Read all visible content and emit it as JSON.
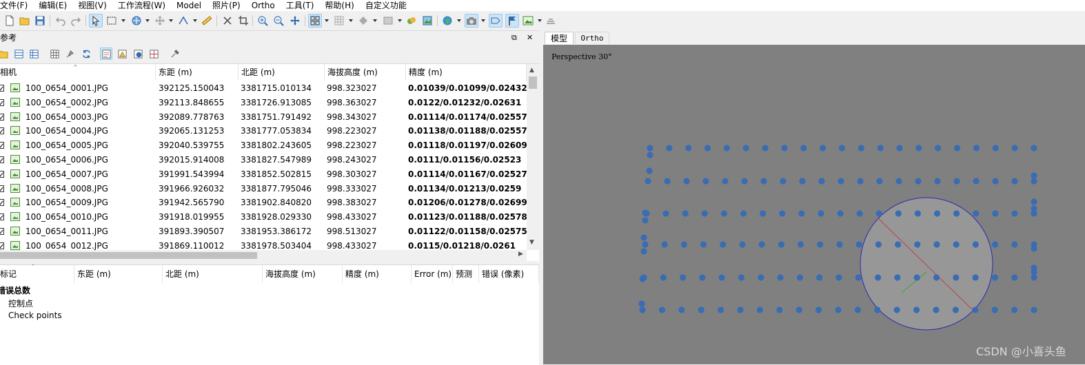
{
  "menu": [
    "文件(F)",
    "编辑(E)",
    "视图(V)",
    "工作流程(W)",
    "Model",
    "照片(P)",
    "Ortho",
    "工具(T)",
    "帮助(H)",
    "自定义功能"
  ],
  "toolbar_icons": [
    "new-icon",
    "open-icon",
    "save-icon",
    "undo-icon",
    "redo-icon",
    "select-icon",
    "rect-select-icon",
    "navigate-icon",
    "move-icon",
    "ruler-icon",
    "measure-icon",
    "delete-icon",
    "crop-icon",
    "zoom-in-icon",
    "zoom-out-icon",
    "pan-icon",
    "grid-view-icon",
    "grid-view-2-icon",
    "shading-icon",
    "dense-icon",
    "texture-icon",
    "tiled-icon",
    "globe-icon",
    "camera-icon",
    "show-cameras-icon",
    "markers-icon",
    "image-icon",
    "surface-icon"
  ],
  "reference_pane": {
    "title": "参考",
    "float_btn": "⧉",
    "close_btn": "✕"
  },
  "camera_table": {
    "headers": [
      "相机",
      "东距 (m)",
      "北距 (m)",
      "海拔高度 (m)",
      "精度 (m)"
    ],
    "rows": [
      {
        "label": "100_0654_0001.JPG",
        "east": "392125.150043",
        "north": "3381715.010134",
        "alt": "998.323027",
        "acc": "0.01039/0.01099/0.02432"
      },
      {
        "label": "100_0654_0002.JPG",
        "east": "392113.848655",
        "north": "3381726.913085",
        "alt": "998.363027",
        "acc": "0.0122/0.01232/0.02631"
      },
      {
        "label": "100_0654_0003.JPG",
        "east": "392089.778763",
        "north": "3381751.791492",
        "alt": "998.343027",
        "acc": "0.01114/0.01174/0.02557"
      },
      {
        "label": "100_0654_0004.JPG",
        "east": "392065.131253",
        "north": "3381777.053834",
        "alt": "998.223027",
        "acc": "0.01138/0.01188/0.02557"
      },
      {
        "label": "100_0654_0005.JPG",
        "east": "392040.539755",
        "north": "3381802.243605",
        "alt": "998.223027",
        "acc": "0.01118/0.01197/0.02609"
      },
      {
        "label": "100_0654_0006.JPG",
        "east": "392015.914008",
        "north": "3381827.547989",
        "alt": "998.243027",
        "acc": "0.0111/0.01156/0.02523"
      },
      {
        "label": "100_0654_0007.JPG",
        "east": "391991.543994",
        "north": "3381852.502815",
        "alt": "998.303027",
        "acc": "0.01114/0.01167/0.02527"
      },
      {
        "label": "100_0654_0008.JPG",
        "east": "391966.926032",
        "north": "3381877.795046",
        "alt": "998.333027",
        "acc": "0.01134/0.01213/0.0259"
      },
      {
        "label": "100_0654_0009.JPG",
        "east": "391942.565790",
        "north": "3381902.840820",
        "alt": "998.383027",
        "acc": "0.01206/0.01278/0.02699"
      },
      {
        "label": "100_0654_0010.JPG",
        "east": "391918.019955",
        "north": "3381928.029330",
        "alt": "998.433027",
        "acc": "0.01123/0.01188/0.02578"
      },
      {
        "label": "100_0654_0011.JPG",
        "east": "391893.390507",
        "north": "3381953.386172",
        "alt": "998.513027",
        "acc": "0.01122/0.01158/0.02575"
      },
      {
        "label": "100_0654_0012.JPG",
        "east": "391869.110012",
        "north": "3381978.503404",
        "alt": "998.433027",
        "acc": "0.0115/0.01218/0.0261"
      }
    ]
  },
  "marker_table": {
    "headers": [
      "标记",
      "东距 (m)",
      "北距 (m)",
      "海拔高度 (m)",
      "精度 (m)",
      "Error (m)",
      "预测",
      "错误 (像素)"
    ],
    "group": "错误总数",
    "items": [
      "控制点",
      "Check points"
    ]
  },
  "viewer": {
    "tabs": [
      "模型",
      "Ortho"
    ],
    "projection": "Perspective 30°",
    "background": "#808080",
    "camera_color": "#3a6cb4"
  },
  "watermark": "CSDN @小喜头鱼"
}
